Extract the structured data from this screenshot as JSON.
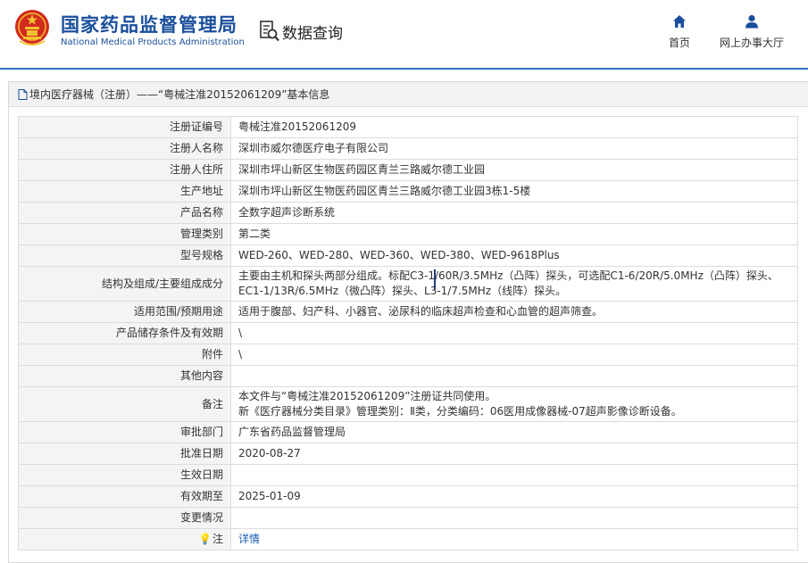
{
  "header": {
    "title_cn": "国家药品监督管理局",
    "title_en": "National Medical Products Administration",
    "query_label": "数据查询",
    "nav": [
      {
        "label": "首页",
        "icon": "home-icon"
      },
      {
        "label": "网上办事大厅",
        "icon": "user-icon"
      }
    ],
    "brand_color": "#1a4f9c",
    "accent_color": "#2d73c4"
  },
  "panel": {
    "title": "境内医疗器械（注册）——“粤械注准20152061209”基本信息"
  },
  "rows": [
    {
      "label": "注册证编号",
      "value": "粤械注准20152061209"
    },
    {
      "label": "注册人名称",
      "value": "深圳市威尔德医疗电子有限公司"
    },
    {
      "label": "注册人住所",
      "value": "深圳市坪山新区生物医药园区青兰三路威尔德工业园"
    },
    {
      "label": "生产地址",
      "value": "深圳市坪山新区生物医药园区青兰三路威尔德工业园3栋1-5楼"
    },
    {
      "label": "产品名称",
      "value": "全数字超声诊断系统"
    },
    {
      "label": "管理类别",
      "value": "第二类"
    },
    {
      "label": "型号规格",
      "value": "WED-260、WED-280、WED-360、WED-380、WED-9618Plus"
    },
    {
      "label": "结构及组成/主要组成成分",
      "value": "主要由主机和探头两部分组成。标配C3-1/60R/3.5MHz（凸阵）探头，可选配C1-6/20R/5.0MHz（凸阵）探头、EC1-1/13R/6.5MHz（微凸阵）探头、L3-1/7.5MHz（线阵）探头。"
    },
    {
      "label": "适用范围/预期用途",
      "value": "适用于腹部、妇产科、小器官、泌尿科的临床超声检查和心血管的超声筛查。"
    },
    {
      "label": "产品储存条件及有效期",
      "value": "\\"
    },
    {
      "label": "附件",
      "value": "\\"
    },
    {
      "label": "其他内容",
      "value": ""
    },
    {
      "label": "备注",
      "value": "本文件与“粤械注准20152061209”注册证共同使用。",
      "value2": "新《医疗器械分类目录》管理类别：Ⅱ类，分类编码：06医用成像器械-07超声影像诊断设备。"
    },
    {
      "label": "审批部门",
      "value": "广东省药品监督管理局"
    },
    {
      "label": "批准日期",
      "value": "2020-08-27"
    },
    {
      "label": "生效日期",
      "value": ""
    },
    {
      "label": "有效期至",
      "value": "2025-01-09"
    },
    {
      "label": "变更情况",
      "value": ""
    },
    {
      "label": "注",
      "icon": "lightbulb-icon",
      "value": "详情"
    }
  ]
}
